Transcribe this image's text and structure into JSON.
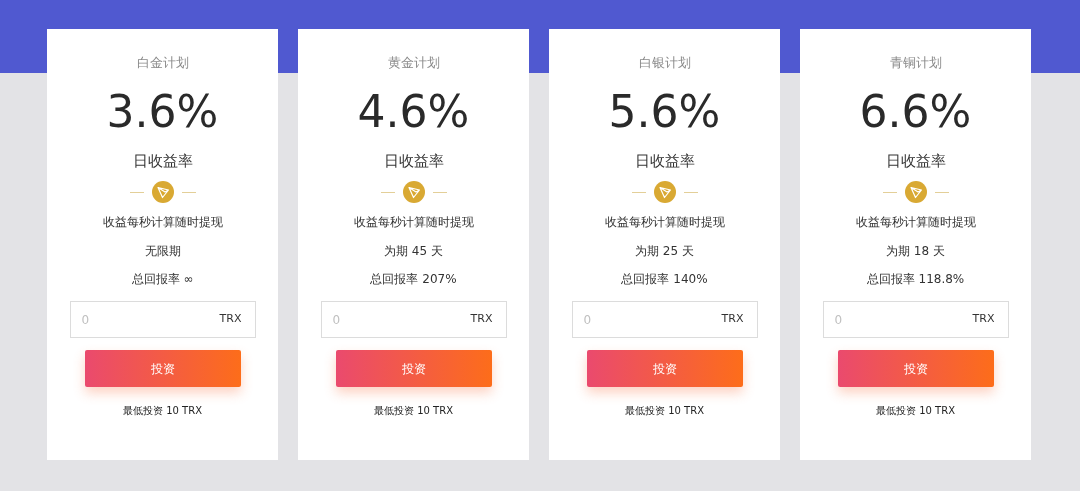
{
  "plans": [
    {
      "title": "白金计划",
      "rate": "3.6%",
      "rate_label": "日收益率",
      "note": "收益每秒计算随时提现",
      "term": "无限期",
      "total_return": "总回报率 ∞",
      "amount": {
        "placeholder": "0",
        "unit": "TRX"
      },
      "button": "投资",
      "minimum": "最低投资 10 TRX"
    },
    {
      "title": "黄金计划",
      "rate": "4.6%",
      "rate_label": "日收益率",
      "note": "收益每秒计算随时提现",
      "term": "为期 45 天",
      "total_return": "总回报率 207%",
      "amount": {
        "placeholder": "0",
        "unit": "TRX"
      },
      "button": "投资",
      "minimum": "最低投资 10 TRX"
    },
    {
      "title": "白银计划",
      "rate": "5.6%",
      "rate_label": "日收益率",
      "note": "收益每秒计算随时提现",
      "term": "为期 25 天",
      "total_return": "总回报率 140%",
      "amount": {
        "placeholder": "0",
        "unit": "TRX"
      },
      "button": "投资",
      "minimum": "最低投资 10 TRX"
    },
    {
      "title": "青铜计划",
      "rate": "6.6%",
      "rate_label": "日收益率",
      "note": "收益每秒计算随时提现",
      "term": "为期 18 天",
      "total_return": "总回报率 118.8%",
      "amount": {
        "placeholder": "0",
        "unit": "TRX"
      },
      "button": "投资",
      "minimum": "最低投资 10 TRX"
    }
  ]
}
